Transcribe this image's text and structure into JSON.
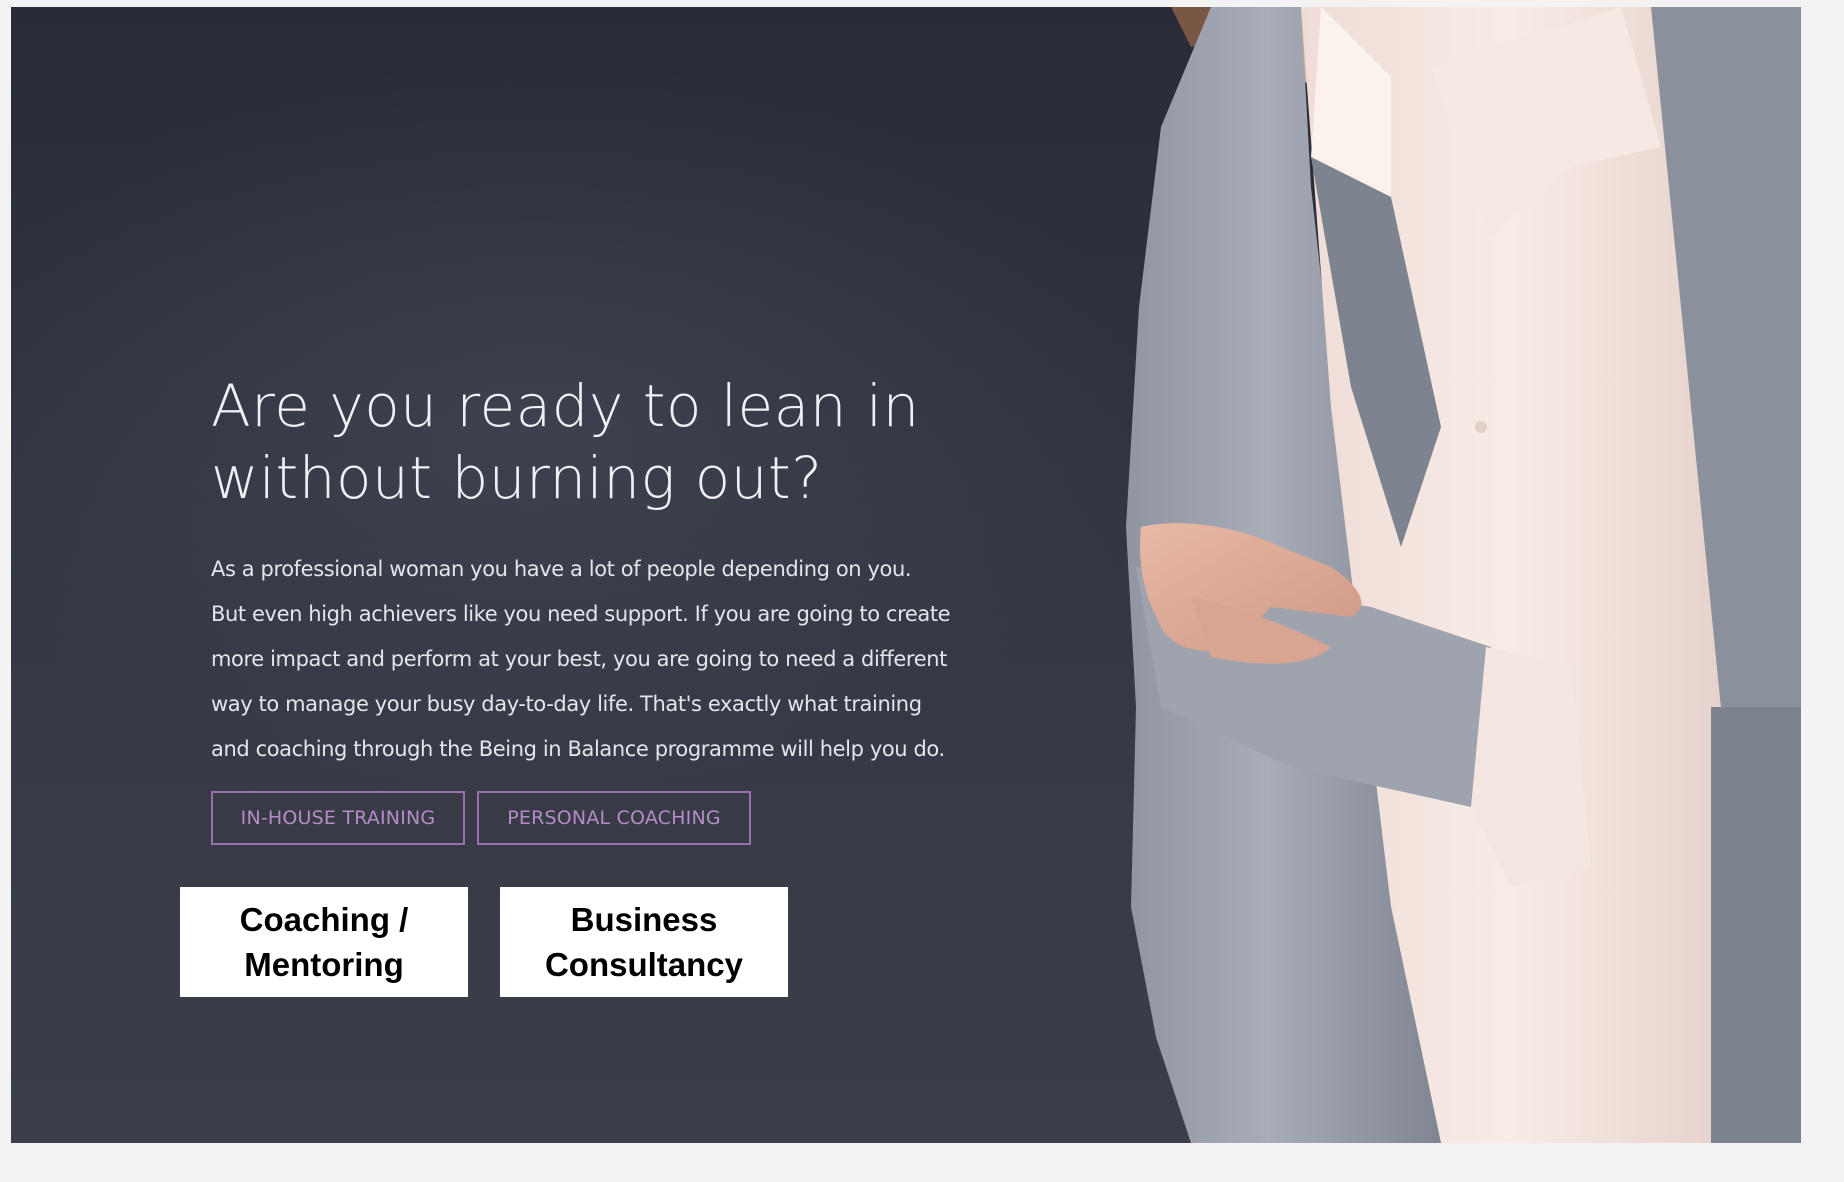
{
  "hero": {
    "headline_line1": "Are you ready to lean in",
    "headline_line2": "without burning out?",
    "body_lines": [
      "As a professional woman you have a lot of people depending on you.",
      "But even high achievers like you need support. If you are going to create",
      "more impact and perform at your best, you are going to need a different",
      "way to manage your busy day-to-day life. That's exactly what training",
      "and coaching through the Being in Balance programme will help you do."
    ],
    "buttons": {
      "in_house_training": "IN-HOUSE TRAINING",
      "personal_coaching": "PERSONAL COACHING"
    },
    "overlay_boxes": {
      "coaching_mentoring": [
        "Coaching /",
        "Mentoring"
      ],
      "business_consultancy": [
        "Business",
        "Consultancy"
      ]
    },
    "photo_subject": "woman-in-grey-blazer-arms-crossed"
  },
  "colors": {
    "background_dark": "#2f323d",
    "page_background": "#f3f3f4",
    "button_accent": "#9a6fb0",
    "button_text": "#b48cc7",
    "headline_text": "#eef0f3",
    "overlay_box_bg": "#ffffff"
  }
}
